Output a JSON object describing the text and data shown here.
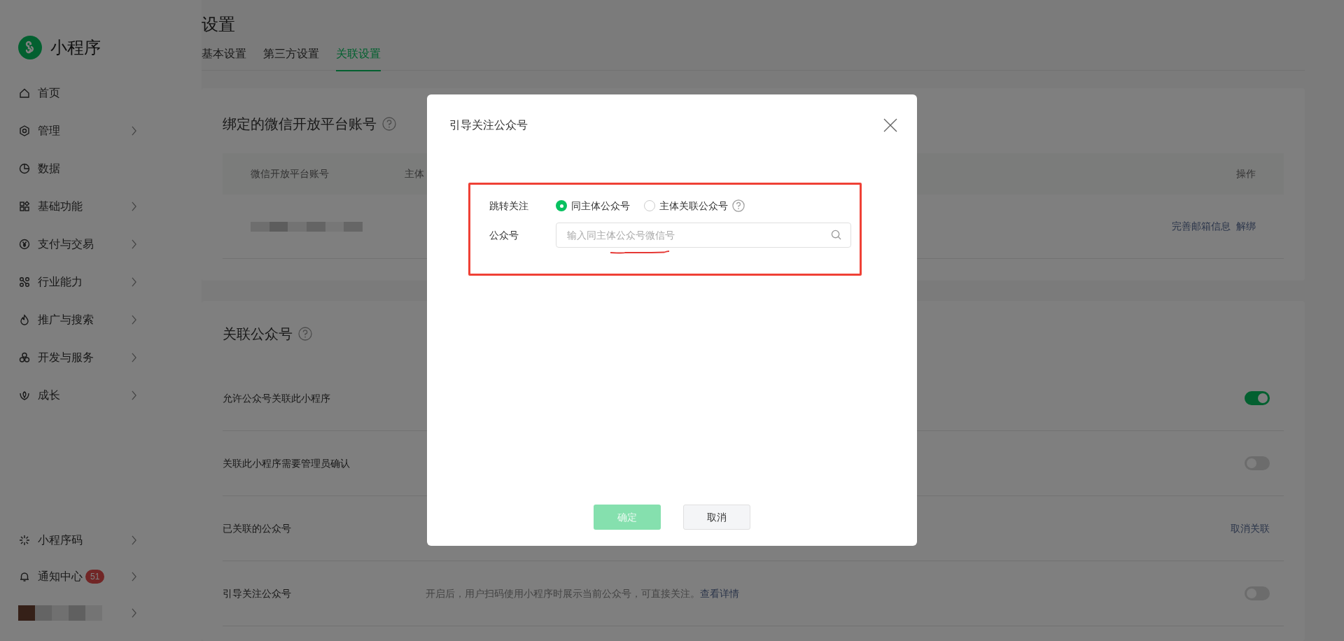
{
  "sidebar": {
    "logo": "小程序",
    "items": [
      {
        "label": "首页",
        "has_arrow": false
      },
      {
        "label": "管理",
        "has_arrow": true
      },
      {
        "label": "数据",
        "has_arrow": false
      },
      {
        "label": "基础功能",
        "has_arrow": true
      },
      {
        "label": "支付与交易",
        "has_arrow": true
      },
      {
        "label": "行业能力",
        "has_arrow": true
      },
      {
        "label": "推广与搜索",
        "has_arrow": true
      },
      {
        "label": "开发与服务",
        "has_arrow": true
      },
      {
        "label": "成长",
        "has_arrow": true
      }
    ],
    "bottom_items": [
      {
        "label": "小程序码"
      },
      {
        "label": "通知中心",
        "badge": "51"
      }
    ]
  },
  "page": {
    "title": "设置",
    "tabs": [
      {
        "label": "基本设置",
        "selected": false
      },
      {
        "label": "第三方设置",
        "selected": false
      },
      {
        "label": "关联设置",
        "selected": true
      }
    ]
  },
  "open_platform_card": {
    "title": "绑定的微信开放平台账号",
    "columns": [
      "微信开放平台账号",
      "主体",
      "操作"
    ],
    "actions": [
      "完善邮箱信息",
      "解绑"
    ]
  },
  "linked_accounts_card": {
    "title": "关联公众号",
    "rows": [
      {
        "label": "允许公众号关联此小程序",
        "kind": "toggle",
        "on": true
      },
      {
        "label": "关联此小程序需要管理员确认",
        "kind": "toggle",
        "on": false
      },
      {
        "label": "已关联的公众号",
        "kind": "link",
        "link": "取消关联"
      },
      {
        "label": "引导关注公众号",
        "kind": "toggle",
        "on": false,
        "description": "开启后，用户扫码使用小程序时展示当前公众号，可直接关注。",
        "description_link": "查看详情"
      }
    ]
  },
  "dialog": {
    "title": "引导关注公众号",
    "radio_label": "跳转关注",
    "options": [
      {
        "label": "同主体公众号",
        "selected": true
      },
      {
        "label": "主体关联公众号",
        "selected": false
      }
    ],
    "input_label": "公众号",
    "placeholder": "输入同主体公众号微信号",
    "confirm": {
      "label": "确定",
      "disabled": true
    },
    "cancel": "取消"
  }
}
